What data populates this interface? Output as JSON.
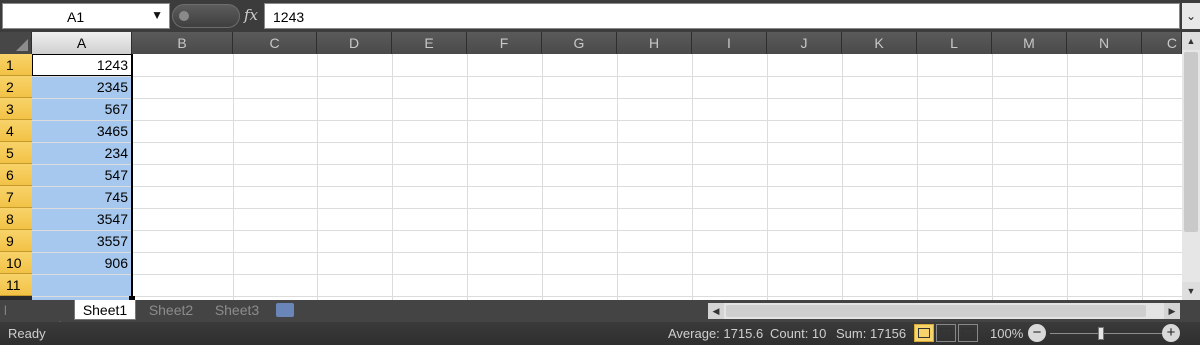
{
  "formula_bar": {
    "name_box": "A1",
    "formula": "1243",
    "fx_label": "fx"
  },
  "columns": [
    "A",
    "B",
    "C",
    "D",
    "E",
    "F",
    "G",
    "H",
    "I",
    "J",
    "K",
    "L",
    "M",
    "N",
    "C"
  ],
  "rows": [
    "1",
    "2",
    "3",
    "4",
    "5",
    "6",
    "7",
    "8",
    "9",
    "10",
    "11"
  ],
  "cells_A": [
    "1243",
    "2345",
    "567",
    "3465",
    "234",
    "547",
    "745",
    "3547",
    "3557",
    "906",
    ""
  ],
  "sheet_tabs": [
    "Sheet1",
    "Sheet2",
    "Sheet3"
  ],
  "status": {
    "ready": "Ready",
    "average": "Average: 1715.6",
    "count": "Count: 10",
    "sum": "Sum: 17156",
    "zoom": "100%"
  },
  "colors": {
    "selection": "#a7c8ee",
    "row_header": "#f2c246",
    "header_bg": "#4a4a4a"
  },
  "icons": {
    "zoom_out": "minus-icon",
    "zoom_in": "plus-icon",
    "new_sheet": "insert-worksheet-icon"
  }
}
